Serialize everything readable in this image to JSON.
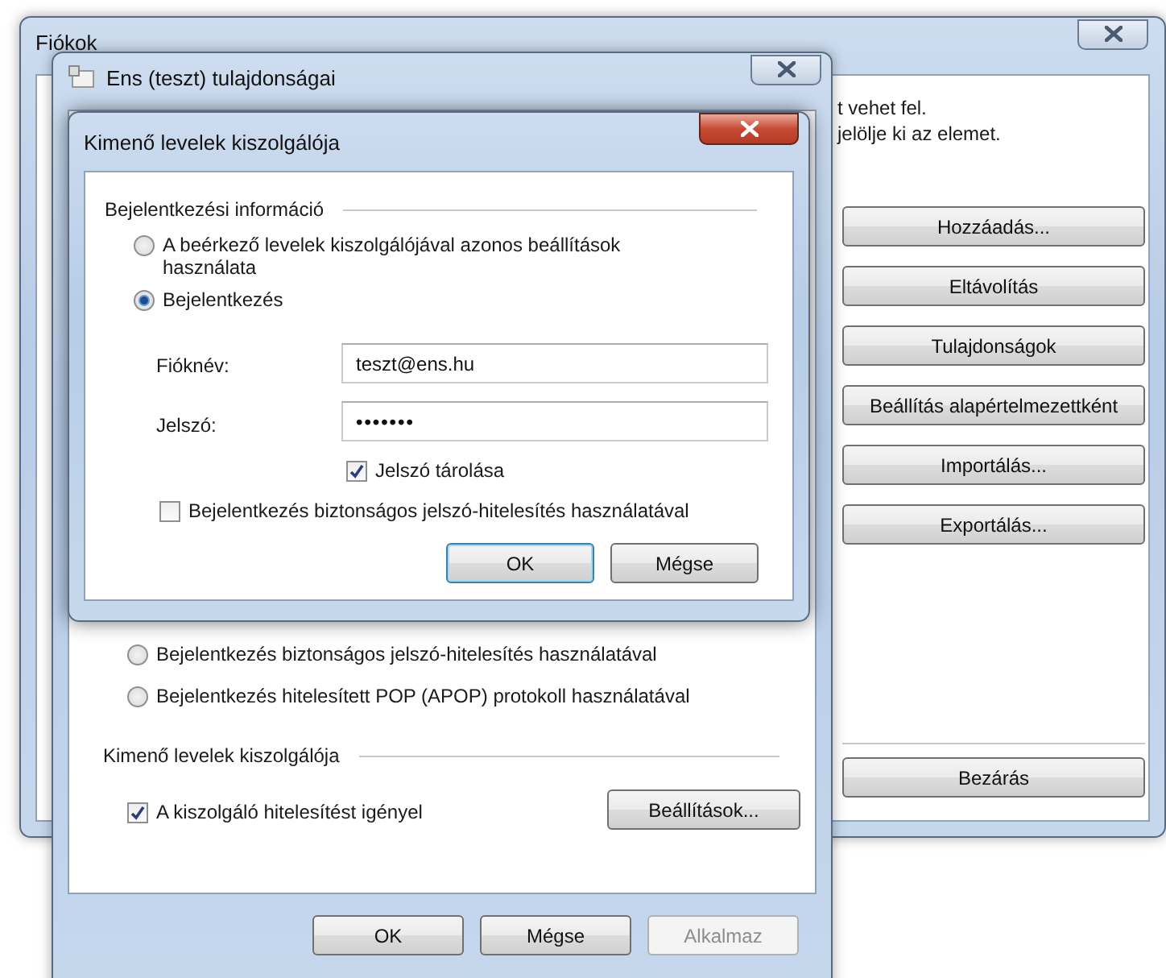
{
  "accounts_window": {
    "title": "Fiókok",
    "text_lines": [
      "t vehet fel.",
      "jelölje ki az elemet."
    ],
    "buttons": [
      "Hozzáadás...",
      "Eltávolítás",
      "Tulajdonságok",
      "Beállítás alapértelmezettként",
      "Importálás...",
      "Exportálás..."
    ],
    "close_button": "Bezárás"
  },
  "properties_window": {
    "title": "Ens (teszt) tulajdonságai",
    "options": [
      {
        "label": "Bejelentkezés biztonságos jelszó-hitelesítés használatával",
        "selected": false
      },
      {
        "label": "Bejelentkezés hitelesített POP (APOP) protokoll használatával",
        "selected": false
      }
    ],
    "outgoing_heading": "Kimenő levelek kiszolgálója",
    "requires_auth": {
      "label": "A kiszolgáló hitelesítést igényel",
      "checked": true
    },
    "settings_button": "Beállítások...",
    "buttons": [
      {
        "label": "OK",
        "disabled": false
      },
      {
        "label": "Mégse",
        "disabled": false
      },
      {
        "label": "Alkalmaz",
        "disabled": true
      }
    ]
  },
  "outgoing_dialog": {
    "title": "Kimenő levelek kiszolgálója",
    "heading": "Bejelentkezési információ",
    "options": [
      {
        "label": "A beérkező levelek kiszolgálójával azonos beállítások használata",
        "selected": false
      },
      {
        "label": "Bejelentkezés",
        "selected": true
      }
    ],
    "account": {
      "label": "Fióknév:",
      "value": "teszt@ens.hu"
    },
    "password": {
      "label": "Jelszó:",
      "value": "•••••••"
    },
    "remember": {
      "label": "Jelszó tárolása",
      "checked": true
    },
    "spa": {
      "label": "Bejelentkezés biztonságos jelszó-hitelesítés használatával",
      "checked": false
    },
    "buttons": [
      {
        "label": "OK",
        "default": true
      },
      {
        "label": "Mégse",
        "default": false
      }
    ]
  }
}
